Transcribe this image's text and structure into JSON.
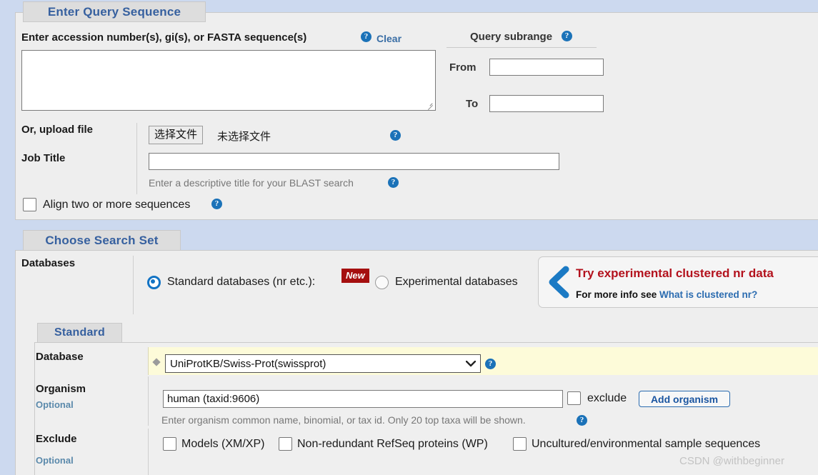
{
  "sections": {
    "query": {
      "tab_label": "Enter Query Sequence",
      "query_label": "Enter accession number(s), gi(s), or FASTA sequence(s)",
      "clear_link": "Clear",
      "textarea_value": "",
      "textarea_placeholder": "",
      "subrange_label": "Query subrange",
      "from_label": "From",
      "from_value": "",
      "to_label": "To",
      "to_value": "",
      "upload_label": "Or, upload file",
      "file_button": "选择文件",
      "file_status": "未选择文件",
      "job_title_label": "Job Title",
      "job_title_value": "",
      "job_title_hint": "Enter a descriptive title for your BLAST search",
      "align_two_label": "Align two or more sequences",
      "align_two_checked": false
    },
    "search_set": {
      "tab_label": "Choose Search Set",
      "databases_label": "Databases",
      "standard_radio_label": "Standard databases (nr etc.):",
      "standard_radio_selected": true,
      "new_badge": "New",
      "experimental_radio_label": "Experimental databases",
      "experimental_radio_selected": false,
      "callout": {
        "title": "Try experimental clustered nr data",
        "sub_prefix": "For more info see ",
        "sub_link": "What is clustered nr?"
      },
      "standard": {
        "tab_label": "Standard",
        "database_label": "Database",
        "database_value": "UniProtKB/Swiss-Prot(swissprot)",
        "organism_label": "Organism",
        "organism_optional": "Optional",
        "organism_value": "human (taxid:9606)",
        "organism_placeholder": "",
        "exclude_checkbox_label": "exclude",
        "exclude_checkbox_checked": false,
        "add_organism_button": "Add organism",
        "organism_hint": "Enter organism common name, binomial, or tax id. Only 20 top taxa will be shown.",
        "exclude_label": "Exclude",
        "exclude_optional": "Optional",
        "exclude_options": [
          {
            "label": "Models (XM/XP)",
            "checked": false
          },
          {
            "label": "Non-redundant RefSeq proteins (WP)",
            "checked": false
          },
          {
            "label": "Uncultured/environmental sample sequences",
            "checked": false
          }
        ]
      }
    }
  },
  "icons": {
    "help": "?",
    "chevron_down": "⌄"
  },
  "watermark": "CSDN @withbeginner",
  "colors": {
    "page_bg": "#ccd9ef",
    "panel_bg": "#eeeeee",
    "tab_text": "#36609f",
    "accent_blue": "#1b72b8",
    "badge_red": "#a50f0f",
    "callout_red": "#b3121d",
    "highlight_yellow": "#fdfbd9"
  }
}
